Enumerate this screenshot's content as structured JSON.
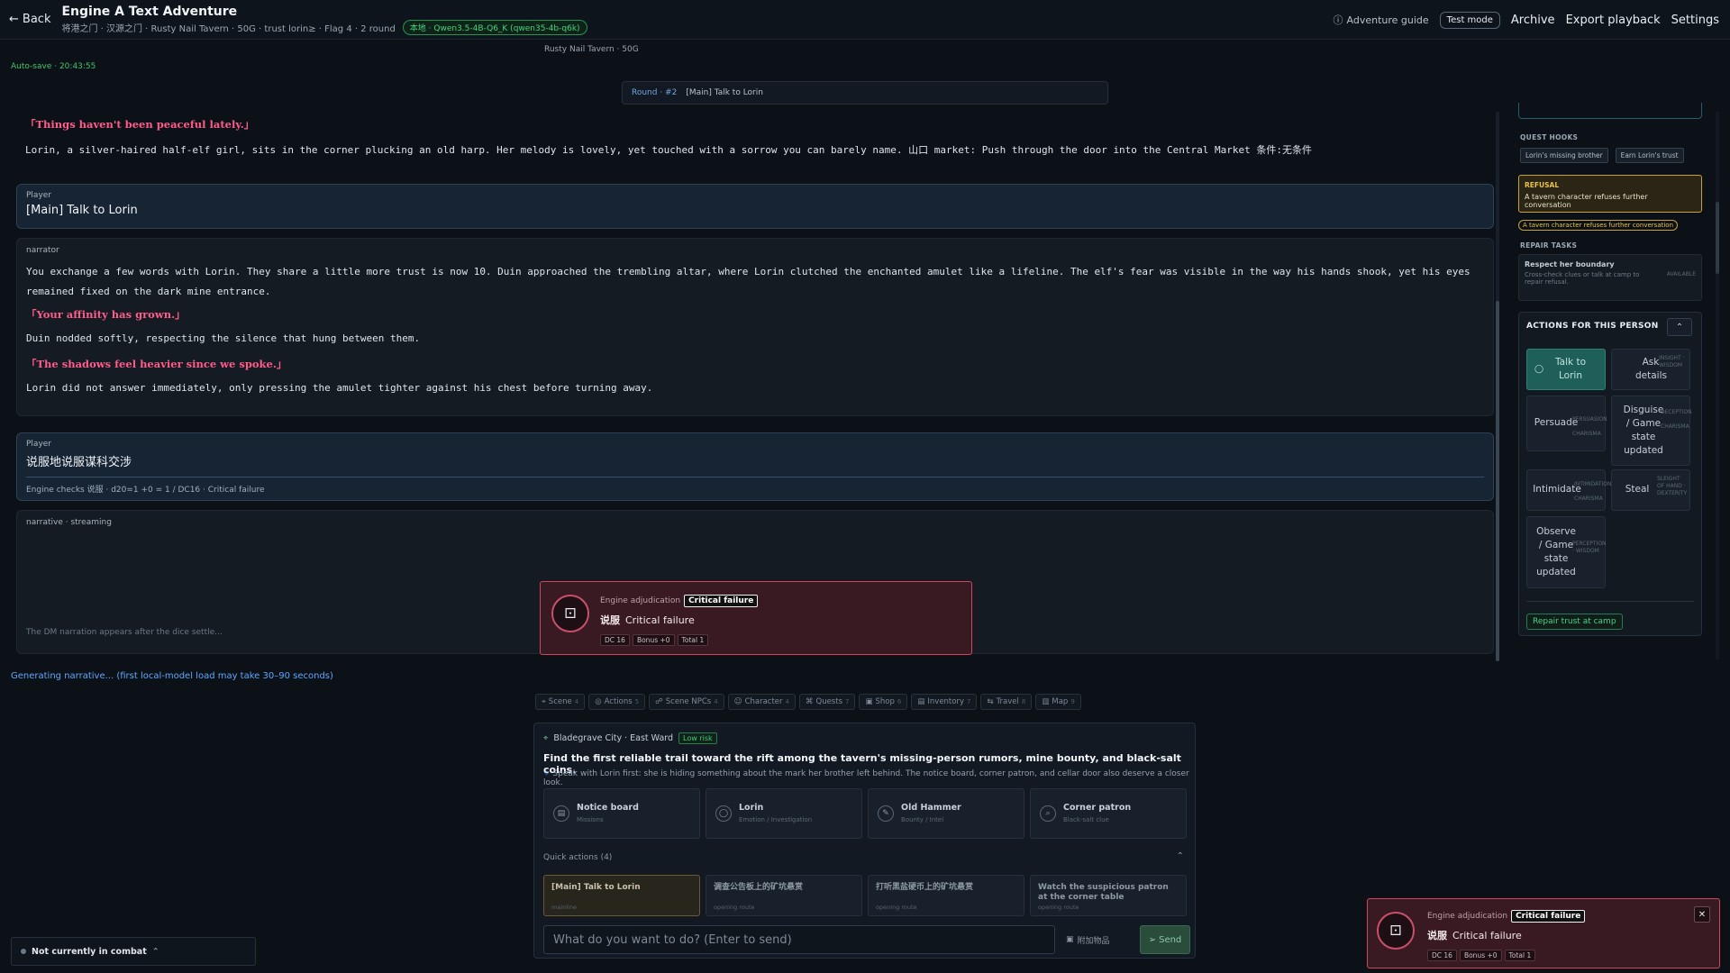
{
  "header": {
    "back_label": "Back",
    "title": "Engine A Text Adventure",
    "subtitle": "将港之门 · 汉源之门 · Rusty Nail Tavern · 50G · trust lorin≥ · Flag 4 · 2 round",
    "model_badge": "本地 · Qwen3.5-4B-Q6_K (qwen35-4b-q6k)",
    "guide_label": "Adventure guide",
    "test_mode_label": "Test mode",
    "buttons": [
      "Archive",
      "Export playback",
      "Settings"
    ]
  },
  "location_center": "Rusty Nail Tavern · 50G",
  "autosave": "Auto-save · 20:43:55",
  "round_bar": {
    "round": "Round · #2",
    "text": "[Main] Talk to Lorin"
  },
  "story": {
    "intro_quote": "「Things haven't been peaceful lately.」",
    "intro_text": "Lorin, a silver-haired half-elf girl, sits in the corner plucking an old harp. Her melody is lovely, yet touched with a sorrow you can barely name. 山口 market: Push through the door into the Central Market 条件:无条件",
    "player1": {
      "label": "Player",
      "text": "[Main] Talk to Lorin"
    },
    "narrator": {
      "label": "narrator",
      "p1": "You exchange a few words with Lorin. They share a little more  trust is now 10. Duin approached the trembling altar, where Lorin clutched the enchanted amulet like a lifeline. The elf's fear was visible in the way his hands shook, yet his eyes remained fixed on the dark mine entrance.",
      "q1": "「Your affinity has grown.」",
      "p2": "Duin nodded softly, respecting the silence that hung between them.",
      "q2": "「The shadows feel heavier since we spoke.」",
      "p3": "Lorin did not answer immediately, only pressing the amulet tighter against his chest before turning away."
    },
    "player2": {
      "label": "Player",
      "text": "说服地说服谋科交涉",
      "check": "Engine checks 说服 · d20=1 +0 = 1 / DC16 · Critical failure"
    },
    "streaming": {
      "label": "narrative · streaming",
      "footer": "The DM narration appears after the dice settle...",
      "dice": {
        "adj_label": "Engine adjudication",
        "badge": "Critical failure",
        "skill": "说服",
        "result": "Critical failure",
        "chips": [
          "DC 16",
          "Bonus +0",
          "Total 1"
        ]
      }
    }
  },
  "sidebar": {
    "quest_hooks_title": "QUEST HOOKS",
    "hooks": [
      "Lorin's missing brother",
      "Earn Lorin's trust"
    ],
    "refusal": {
      "title": "REFUSAL",
      "text": "A tavern character refuses further conversation",
      "pill": "A tavern character refuses further conversation"
    },
    "repair_title": "REPAIR TASKS",
    "repair_item": {
      "title": "Respect her boundary",
      "desc": "Cross-check clues or talk at camp to repair refusal.",
      "status": "AVAILABLE"
    },
    "actions_title": "ACTIONS FOR THIS PERSON",
    "actions": {
      "talk": "Talk to Lorin",
      "ask": "Ask details",
      "ask_tag": "INSIGHT · WISDOM",
      "persuade": "Persuade",
      "persuade_tag": "PERSUASION · CHARISMA",
      "disguise": "Disguise / Game state updated",
      "disguise_tag": "DECEPTION · CHARISMA",
      "intimidate": "Intimidate",
      "intimidate_tag": "INTIMIDATION · CHARISMA",
      "steal": "Steal",
      "steal_tag": "SLEIGHT OF HAND · DEXTERITY",
      "observe": "Observe / Game state updated",
      "observe_tag": "PERCEPTION · WISDOM"
    },
    "repair_button": "Repair trust at camp"
  },
  "generating": "Generating narrative... (first local-model load may take 30–90 seconds)",
  "tabs": [
    {
      "label": "Scene",
      "count": "4"
    },
    {
      "label": "Actions",
      "count": "5"
    },
    {
      "label": "Scene NPCs",
      "count": "4"
    },
    {
      "label": "Character",
      "count": "4"
    },
    {
      "label": "Quests",
      "count": "7"
    },
    {
      "label": "Shop",
      "count": "6"
    },
    {
      "label": "Inventory",
      "count": "7"
    },
    {
      "label": "Travel",
      "count": "8"
    },
    {
      "label": "Map",
      "count": "9"
    }
  ],
  "scene": {
    "location": "Bladegrave City · East Ward",
    "risk": "Low risk",
    "goal": "Find the first reliable trail toward the rift among the tavern's missing-person rumors, mine bounty, and black-salt coins.",
    "hint": "Speak with Lorin first: she is hiding something about the mark her brother left behind. The notice board, corner patron, and cellar door also deserve a closer look.",
    "npcs": [
      {
        "name": "Notice board",
        "sub": "Missions",
        "icon": "▤"
      },
      {
        "name": "Lorin",
        "sub": "Emotion / Investigation",
        "icon": "◯"
      },
      {
        "name": "Old Hammer",
        "sub": "Bounty / Intel",
        "icon": "✎"
      },
      {
        "name": "Corner patron",
        "sub": "Black-salt clue",
        "icon": "⌕"
      }
    ],
    "quick_label": "Quick actions (4)",
    "quick": [
      {
        "title": "[Main] Talk to Lorin",
        "sub": "mainline"
      },
      {
        "title": "调查公告板上的矿坑悬赏",
        "sub": "opening route"
      },
      {
        "title": "打听黑盐硬币上的矿坑悬赏",
        "sub": "opening route"
      },
      {
        "title": "Watch the suspicious patron at the corner table",
        "sub": "opening route"
      }
    ],
    "input_placeholder": "What do you want to do? (Enter to send)",
    "attach_label": "附加物品",
    "send_label": "Send"
  },
  "combat": "Not currently in combat",
  "toast": {
    "adj_label": "Engine adjudication",
    "badge": "Critical failure",
    "skill": "说服",
    "result": "Critical failure",
    "chips": [
      "DC 16",
      "Bonus +0",
      "Total 1"
    ]
  }
}
